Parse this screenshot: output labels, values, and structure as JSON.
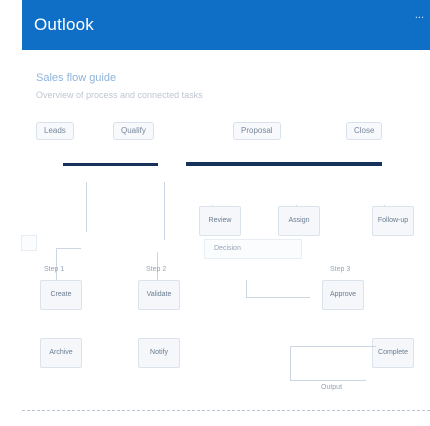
{
  "app": {
    "brand": "Outlook",
    "top_right": "..."
  },
  "page": {
    "title": "Sales flow guide",
    "subtitle": "Overview of process and connected tasks"
  },
  "chips": [
    {
      "label": "Leads"
    },
    {
      "label": "Qualify"
    },
    {
      "label": "Proposal"
    },
    {
      "label": "Close"
    }
  ],
  "nodes": [
    {
      "label": "Review"
    },
    {
      "label": "Assign"
    },
    {
      "label": "Follow-up"
    },
    {
      "label": "Create"
    },
    {
      "label": "Validate"
    },
    {
      "label": "Approve"
    },
    {
      "label": "Archive"
    },
    {
      "label": "Notify"
    },
    {
      "label": "Complete"
    }
  ],
  "labels": [
    {
      "text": "Step 1"
    },
    {
      "text": "Step 2"
    },
    {
      "text": "Step 3"
    },
    {
      "text": "Decision"
    },
    {
      "text": "Output"
    }
  ]
}
